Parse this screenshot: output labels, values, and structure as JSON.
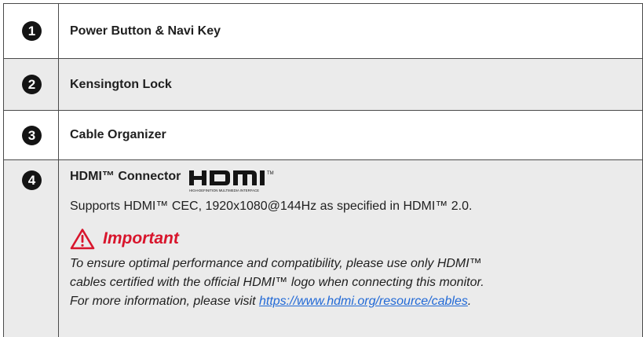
{
  "rows": [
    {
      "number": "1",
      "title": "Power Button & Navi Key"
    },
    {
      "number": "2",
      "title": "Kensington Lock"
    },
    {
      "number": "3",
      "title": "Cable Organizer"
    },
    {
      "number": "4",
      "title": "HDMI™ Connector",
      "logo_tagline": "HIGH-DEFINITION MULTIMEDIA INTERFACE",
      "description": "Supports HDMI™ CEC, 1920x1080@144Hz as specified in HDMI™ 2.0.",
      "important_label": "Important",
      "note_line1": "To ensure optimal performance and compatibility, please use only HDMI™",
      "note_line2": "cables certified with the official HDMI™ logo when connecting this monitor.",
      "note_line3_prefix": "For more information, please visit ",
      "note_link": "https://www.hdmi.org/resource/cables",
      "note_line3_suffix": "."
    }
  ],
  "colors": {
    "important": "#d8152c",
    "link": "#2169d6",
    "shaded_row": "#ebebeb",
    "badge": "#141414"
  },
  "icons": {
    "warning": "warning-triangle-icon",
    "logo": "hdmi-logo"
  }
}
